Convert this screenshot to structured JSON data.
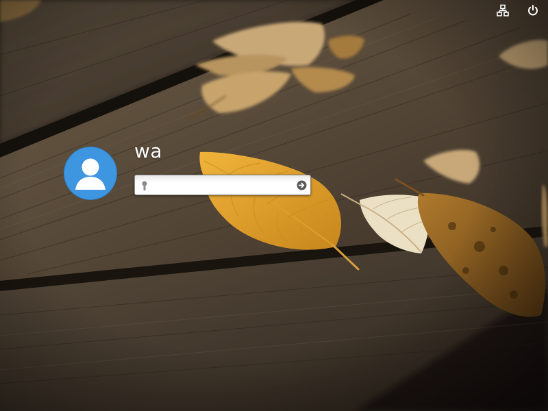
{
  "login": {
    "username": "wa",
    "password_value": "",
    "password_placeholder": ""
  },
  "top_bar": {
    "icons": [
      "network-icon",
      "power-icon"
    ]
  },
  "colors": {
    "avatar_blue": "#3e95e0",
    "text": "#ffffff",
    "icon": "#ffffff"
  }
}
